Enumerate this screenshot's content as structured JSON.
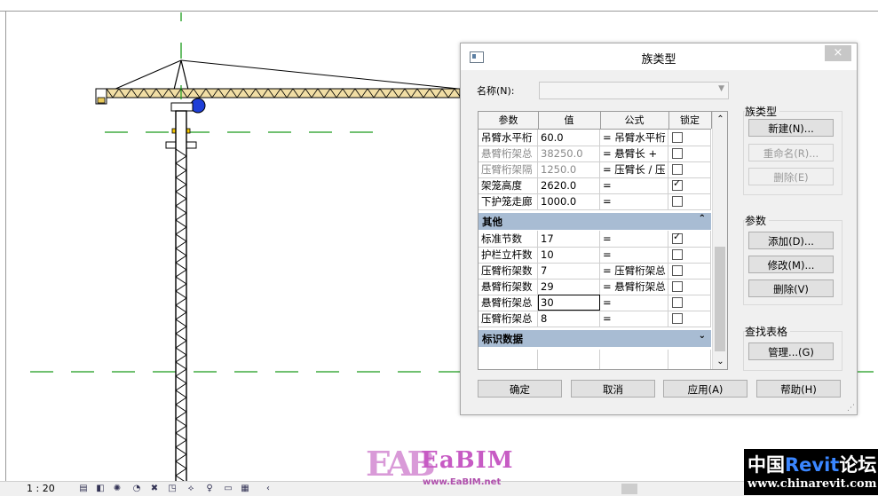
{
  "dialog": {
    "title": "族类型",
    "close": "×",
    "name_label": "名称(N):",
    "name_value": "",
    "grid": {
      "headers": [
        "参数",
        "值",
        "公式",
        "锁定"
      ],
      "rows_top": [
        {
          "param": "吊臂水平桁",
          "value": "60.0",
          "formula": "= 吊臂水平桁",
          "locked": false,
          "dim": false
        },
        {
          "param": "悬臂桁架总",
          "value": "38250.0",
          "formula": "= 悬臂长 +",
          "locked": false,
          "dim": true
        },
        {
          "param": "压臂桁架隔",
          "value": "1250.0",
          "formula": "= 压臂长 / 压",
          "locked": false,
          "dim": true
        },
        {
          "param": "架笼高度",
          "value": "2620.0",
          "formula": "=",
          "locked": true,
          "dim": false
        },
        {
          "param": "下护笼走廊",
          "value": "1000.0",
          "formula": "=",
          "locked": false,
          "dim": false
        }
      ],
      "group_other": {
        "label": "其他",
        "toggle": "⌃"
      },
      "rows_other": [
        {
          "param": "标准节数",
          "value": "17",
          "formula": "=",
          "locked": true,
          "dim": false
        },
        {
          "param": "护栏立杆数",
          "value": "10",
          "formula": "=",
          "locked": false,
          "dim": false
        },
        {
          "param": "压臂桁架数",
          "value": "7",
          "formula": "= 压臂桁架总",
          "locked": false,
          "dim": false
        },
        {
          "param": "悬臂桁架数",
          "value": "29",
          "formula": "= 悬臂桁架总",
          "locked": false,
          "dim": false
        },
        {
          "param": "悬臂桁架总",
          "value": "30",
          "formula": "=",
          "locked": false,
          "dim": false
        },
        {
          "param": "压臂桁架总",
          "value": "8",
          "formula": "=",
          "locked": false,
          "dim": false
        }
      ],
      "group_identity": {
        "label": "标识数据",
        "toggle": "⌄"
      }
    },
    "family_types": {
      "title": "族类型",
      "new": "新建(N)...",
      "rename": "重命名(R)...",
      "delete": "删除(E)"
    },
    "parameters": {
      "title": "参数",
      "add": "添加(D)...",
      "modify": "修改(M)...",
      "remove": "删除(V)"
    },
    "lookup": {
      "title": "查找表格",
      "manage": "管理...(G)"
    },
    "footer": {
      "ok": "确定",
      "cancel": "取消",
      "apply": "应用(A)",
      "help": "帮助(H)"
    }
  },
  "status": {
    "scale": "1 : 20"
  },
  "watermarks": {
    "eabim_logo": "EAB",
    "eabim_word": "EaBIM",
    "eabim_url": "www.EaBIM.net",
    "cr_prefix": "中国",
    "cr_revit": "Revit",
    "cr_suffix": "论坛",
    "cr_url": "www.chinarevit.com"
  }
}
